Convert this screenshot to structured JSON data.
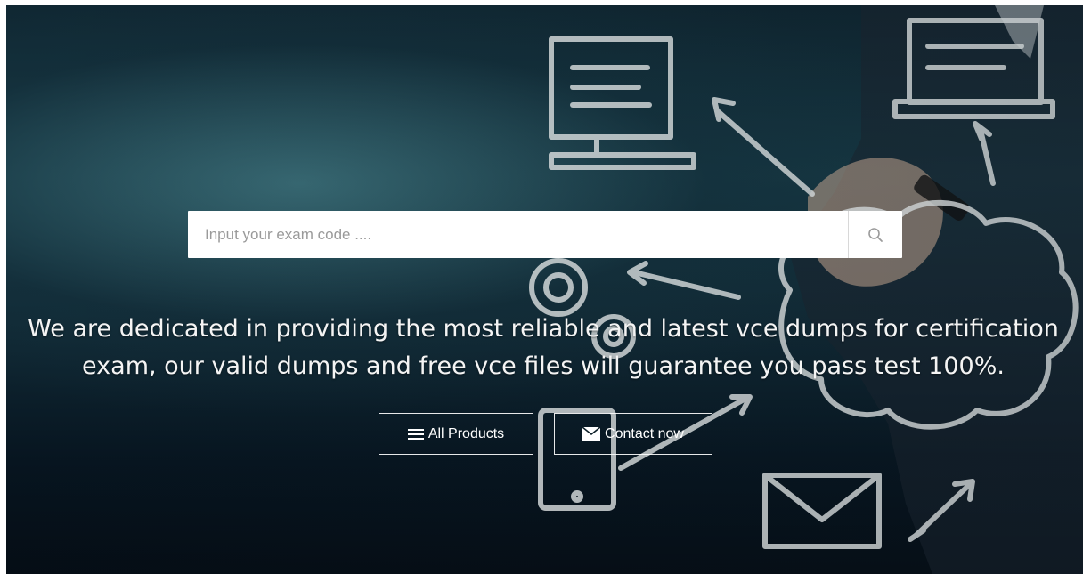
{
  "search": {
    "placeholder": "Input your exam code ....",
    "button_icon": "search-icon"
  },
  "hero": {
    "tagline": "We are dedicated in providing the most reliable and latest vce dumps for certification exam, our valid dumps and free vce files will guarantee you pass test 100%."
  },
  "buttons": {
    "all_products": {
      "label": "All Products",
      "icon": "list-icon"
    },
    "contact": {
      "label": "Contact now",
      "icon": "envelope-icon"
    }
  },
  "background": {
    "illustration": "hand drawing chalk cloud network sketch",
    "colors": {
      "sky": "#173b47",
      "dark": "#050d15",
      "chalk": "#e8ecec"
    }
  }
}
